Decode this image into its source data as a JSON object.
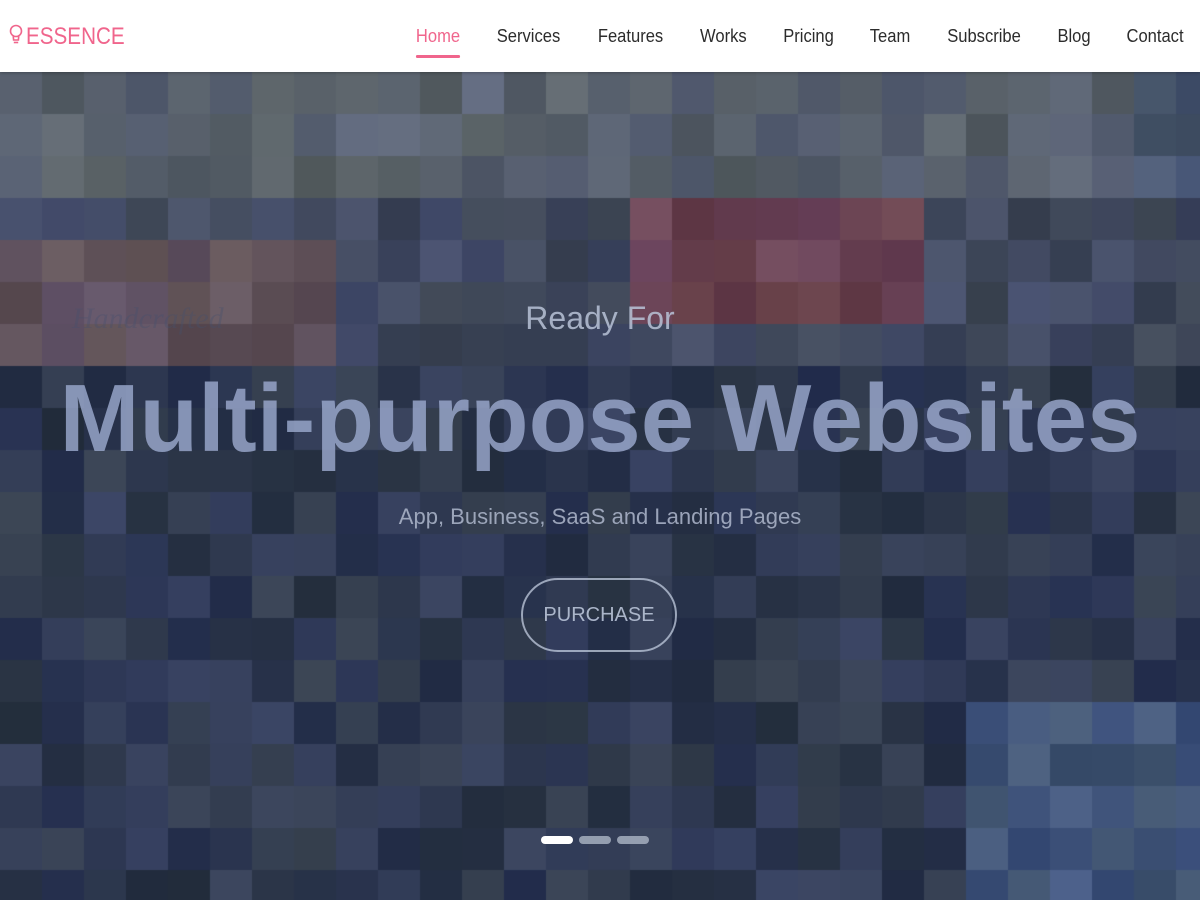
{
  "brand": {
    "name": "ESSENCE",
    "logo_icon": "lightbulb-icon",
    "accent_color": "#f0658c"
  },
  "nav": {
    "items": [
      {
        "label": "Home",
        "active": true
      },
      {
        "label": "Services",
        "active": false
      },
      {
        "label": "Features",
        "active": false
      },
      {
        "label": "Works",
        "active": false
      },
      {
        "label": "Pricing",
        "active": false
      },
      {
        "label": "Team",
        "active": false
      },
      {
        "label": "Subscribe",
        "active": false
      },
      {
        "label": "Blog",
        "active": false
      },
      {
        "label": "Contact",
        "active": false
      }
    ]
  },
  "hero": {
    "faded_text": "Handcrafted",
    "pre_title": "Ready For",
    "title": "Multi-purpose Websites",
    "subtitle": "App, Business, SaaS and Landing Pages",
    "cta_label": "PURCHASE",
    "slides": 3,
    "active_slide": 1
  }
}
